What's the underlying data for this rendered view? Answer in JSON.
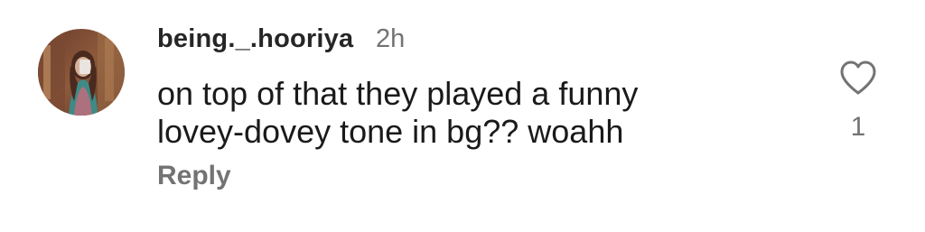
{
  "comment": {
    "username": "being._.hooriya",
    "timestamp": "2h",
    "text_lines": [
      "on top of that they played a funny",
      "lovey-dovey tone in bg?? woahh"
    ],
    "reply_label": "Reply",
    "like_count": "1",
    "like_icon": "heart-outline-icon",
    "avatar_icon": "user-avatar"
  },
  "colors": {
    "username": "#262626",
    "secondary_text": "#737373",
    "body_text": "#1a1a1a",
    "background": "#ffffff"
  }
}
